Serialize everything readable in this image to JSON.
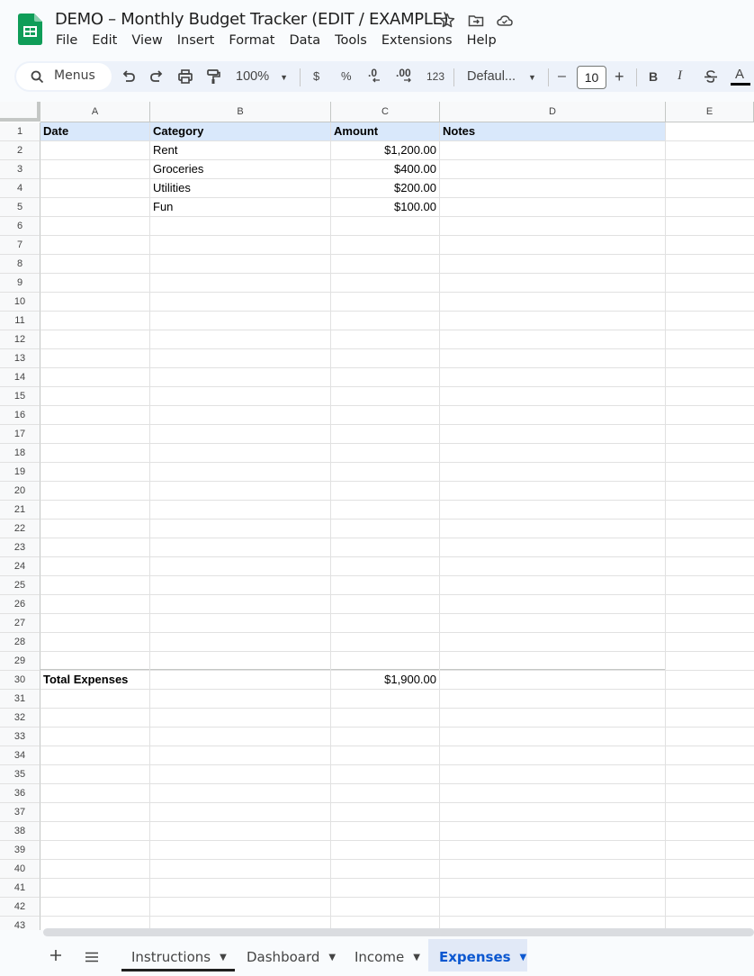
{
  "app": {
    "title": "DEMO – Monthly Budget Tracker (EDIT / EXAMPLE)",
    "menus": [
      "File",
      "Edit",
      "View",
      "Insert",
      "Format",
      "Data",
      "Tools",
      "Extensions",
      "Help"
    ]
  },
  "toolbar": {
    "search_label": "Menus",
    "zoom": "100%",
    "currency": "$",
    "percent": "%",
    "decrease_decimal": ".0",
    "increase_decimal": ".00",
    "number_format": "123",
    "font": "Defaul...",
    "font_size": "10",
    "minus": "–",
    "plus": "+",
    "bold": "B",
    "italic": "I",
    "text_color": "A"
  },
  "columns": [
    "A",
    "B",
    "C",
    "D",
    "E"
  ],
  "header_row": {
    "a": "Date",
    "b": "Category",
    "c": "Amount",
    "d": "Notes"
  },
  "rows": [
    {
      "category": "Rent",
      "amount": "$1,200.00"
    },
    {
      "category": "Groceries",
      "amount": "$400.00"
    },
    {
      "category": "Utilities",
      "amount": "$200.00"
    },
    {
      "category": "Fun",
      "amount": "$100.00"
    }
  ],
  "total": {
    "label": "Total Expenses",
    "amount": "$1,900.00"
  },
  "sheets": [
    {
      "name": "Instructions"
    },
    {
      "name": "Dashboard"
    },
    {
      "name": "Income"
    },
    {
      "name": "Expenses",
      "active": true
    }
  ],
  "colors": {
    "header_fill": "#d9e8fb",
    "active_tab": "#0b57d0",
    "sheets_green": "#0f9d58"
  }
}
